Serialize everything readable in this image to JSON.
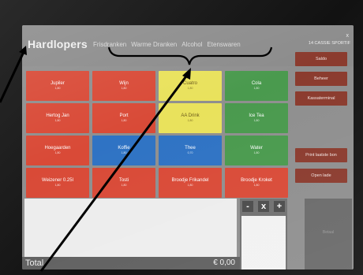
{
  "app": {
    "title": "Hardlopers",
    "user_label": "14 CASSIE SPORTIF",
    "close_symbol": "x"
  },
  "category_tabs": [
    "Frisdranken",
    "Warme Dranken",
    "Alcohol",
    "Etenswaren"
  ],
  "products": [
    {
      "name": "Jupiler",
      "price": "1,80",
      "color": "#d94a37",
      "tone": "red"
    },
    {
      "name": "Wijn",
      "price": "1,80",
      "color": "#d94a37",
      "tone": "red"
    },
    {
      "name": "Cuatro",
      "price": "1,80",
      "color": "#e9e25c",
      "tone": "yellow"
    },
    {
      "name": "Cola",
      "price": "1,80",
      "color": "#4a9a4e",
      "tone": "green"
    },
    {
      "name": "Hertog Jan",
      "price": "1,80",
      "color": "#d94a37",
      "tone": "red"
    },
    {
      "name": "Port",
      "price": "1,80",
      "color": "#d94a37",
      "tone": "red"
    },
    {
      "name": "AA Drink",
      "price": "1,80",
      "color": "#e9e25c",
      "tone": "yellow"
    },
    {
      "name": "Ice Tea",
      "price": "1,80",
      "color": "#4a9a4e",
      "tone": "green"
    },
    {
      "name": "Hoegaarden",
      "price": "1,80",
      "color": "#d94a37",
      "tone": "red"
    },
    {
      "name": "Koffie",
      "price": "1,80",
      "color": "#2f73c4",
      "tone": "blue"
    },
    {
      "name": "Thee",
      "price": "0,70",
      "color": "#2f73c4",
      "tone": "blue"
    },
    {
      "name": "Water",
      "price": "1,80",
      "color": "#4a9a4e",
      "tone": "green"
    },
    {
      "name": "Weizener 0.25l",
      "price": "1,80",
      "color": "#d94a37",
      "tone": "red"
    },
    {
      "name": "Tosti",
      "price": "1,80",
      "color": "#d94a37",
      "tone": "red"
    },
    {
      "name": "Broodje Frikandel",
      "price": "1,80",
      "color": "#d94a37",
      "tone": "red"
    },
    {
      "name": "Broodje Kroket",
      "price": "1,80",
      "color": "#d94a37",
      "tone": "red"
    }
  ],
  "right_panel": {
    "top_buttons": [
      "Saldo",
      "Beheer",
      "Kassaterminal"
    ],
    "bottom_buttons": [
      "Print laatste bon",
      "Open lade"
    ]
  },
  "stepper": {
    "minus": "-",
    "times": "x",
    "plus": "+"
  },
  "total": {
    "label": "Total",
    "value": "€ 0,00"
  },
  "side_block": {
    "label": "Betaal"
  },
  "colors": {
    "screen_bg": "#8f8f8f",
    "action_button": "#8b3b2e",
    "annotation": "#000000"
  }
}
